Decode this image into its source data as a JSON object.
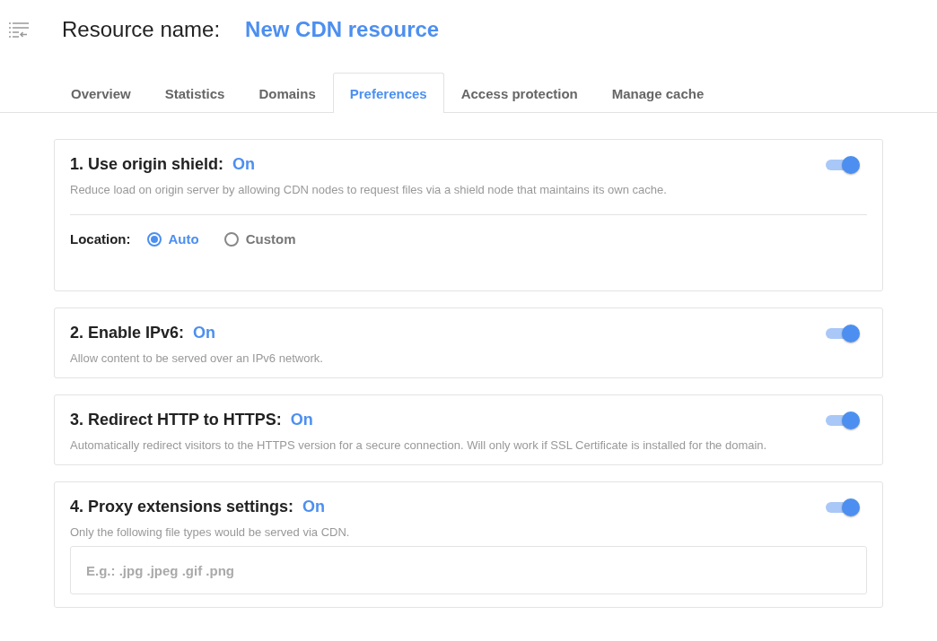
{
  "header": {
    "label": "Resource name:",
    "name": "New CDN resource"
  },
  "tabs": [
    {
      "label": "Overview",
      "selected": false
    },
    {
      "label": "Statistics",
      "selected": false
    },
    {
      "label": "Domains",
      "selected": false
    },
    {
      "label": "Preferences",
      "selected": true
    },
    {
      "label": "Access protection",
      "selected": false
    },
    {
      "label": "Manage cache",
      "selected": false
    }
  ],
  "settings": [
    {
      "kind": "radio",
      "title": "1. Use origin shield:",
      "status": "On",
      "on": true,
      "description": "Reduce load on origin server by allowing CDN nodes to request files via a shield node that maintains its own cache.",
      "field_label": "Location:",
      "options": [
        {
          "label": "Auto",
          "selected": true
        },
        {
          "label": "Custom",
          "selected": false
        }
      ]
    },
    {
      "kind": "plain",
      "title": "2. Enable IPv6:",
      "status": "On",
      "on": true,
      "description": "Allow content to be served over an IPv6 network."
    },
    {
      "kind": "plain",
      "title": "3. Redirect HTTP to HTTPS:",
      "status": "On",
      "on": true,
      "description": "Automatically redirect visitors to the HTTPS version for a secure connection. Will only work if SSL Certificate is installed for the domain."
    },
    {
      "kind": "input",
      "title": "4. Proxy extensions settings:",
      "status": "On",
      "on": true,
      "description": "Only the following file types would be served via CDN.",
      "placeholder": "E.g.: .jpg .jpeg .gif .png"
    }
  ]
}
